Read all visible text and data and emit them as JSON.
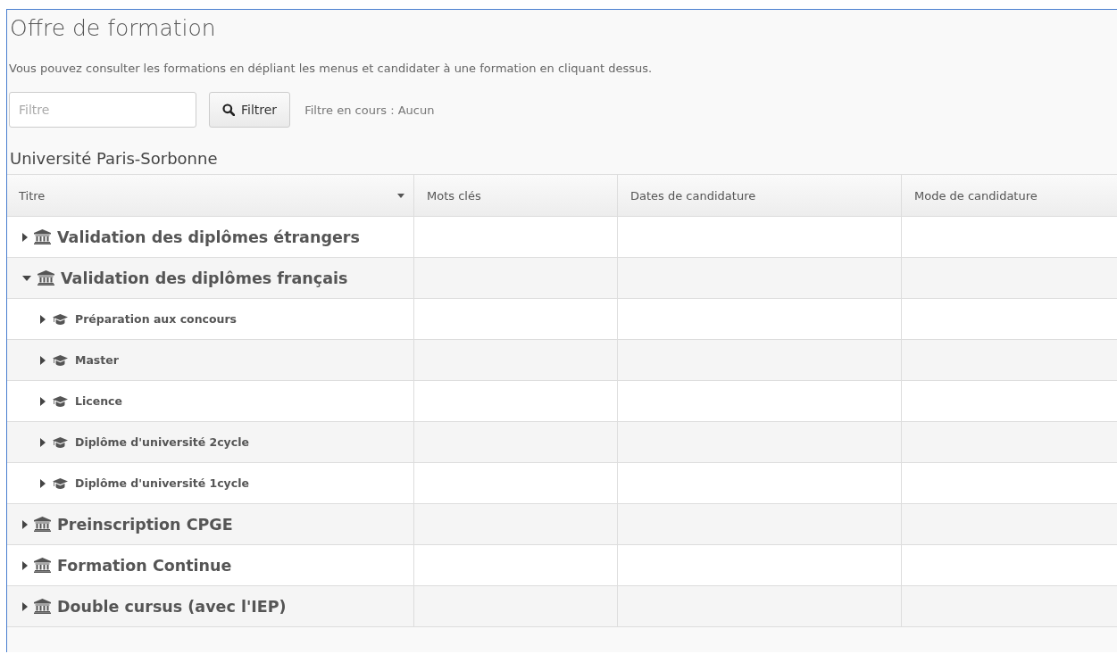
{
  "page": {
    "title": "Offre de formation",
    "intro": "Vous pouvez consulter les formations en dépliant les menus et candidater à une formation en cliquant dessus."
  },
  "filter": {
    "placeholder": "Filtre",
    "button": "Filtrer",
    "status": "Filtre en cours : Aucun"
  },
  "university": "Université Paris-Sorbonne",
  "table": {
    "columns": [
      {
        "label": "Titre",
        "sortable": true
      },
      {
        "label": "Mots clés",
        "sortable": false
      },
      {
        "label": "Dates de candidature",
        "sortable": false
      },
      {
        "label": "Mode de candidature",
        "sortable": false
      }
    ],
    "rows": [
      {
        "kind": "institution",
        "title": "Validation des diplômes étrangers",
        "expanded": false
      },
      {
        "kind": "institution",
        "title": "Validation des diplômes français",
        "expanded": true,
        "children": [
          {
            "kind": "degree",
            "title": "Préparation aux concours",
            "expanded": false
          },
          {
            "kind": "degree",
            "title": "Master",
            "expanded": false
          },
          {
            "kind": "degree",
            "title": "Licence",
            "expanded": false
          },
          {
            "kind": "degree",
            "title": "Diplôme d'université 2cycle",
            "expanded": false
          },
          {
            "kind": "degree",
            "title": "Diplôme d'université 1cycle",
            "expanded": false
          }
        ]
      },
      {
        "kind": "institution",
        "title": "Preinscription CPGE",
        "expanded": false
      },
      {
        "kind": "institution",
        "title": "Formation Continue",
        "expanded": false
      },
      {
        "kind": "institution",
        "title": "Double cursus (avec l'IEP)",
        "expanded": false
      }
    ]
  }
}
